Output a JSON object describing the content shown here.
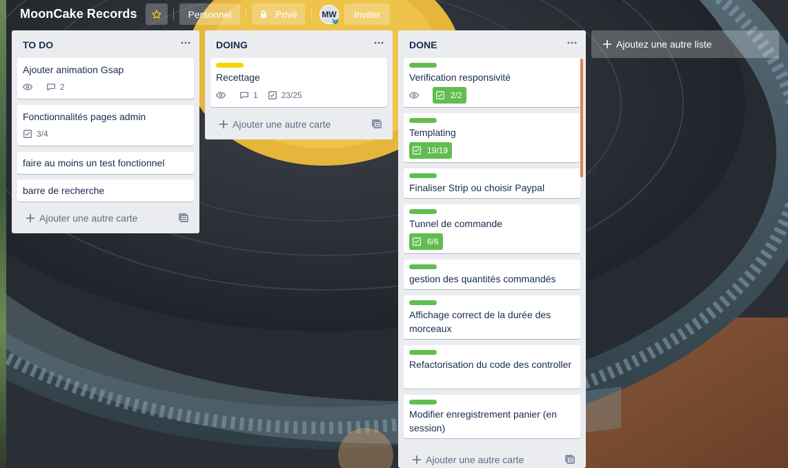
{
  "board": {
    "title": "MoonCake Records"
  },
  "header": {
    "star_icon": "star-icon",
    "visibility_team": "Personnel",
    "privacy_label": "Privé",
    "member_initials": "MW",
    "invite_label": "Inviter"
  },
  "colors": {
    "label_green": "#61bd4f",
    "label_yellow": "#f2d600",
    "done_badge": "#61bd4f",
    "list_bg": "#ebecf0"
  },
  "lists": [
    {
      "title": "TO DO",
      "add_card_label": "Ajouter une autre carte",
      "cards": [
        {
          "title": "Ajouter animation Gsap",
          "watch": true,
          "comments": "2"
        },
        {
          "title": "Fonctionnalités pages admin",
          "checklist": "3/4"
        },
        {
          "title": "faire au moins un test fonctionnel"
        },
        {
          "title": "barre de recherche"
        }
      ]
    },
    {
      "title": "DOING",
      "add_card_label": "Ajouter une autre carte",
      "cards": [
        {
          "title": "Recettage",
          "label": "yellow",
          "watch": true,
          "comments": "1",
          "checklist": "23/25"
        }
      ]
    },
    {
      "title": "DONE",
      "add_card_label": "Ajouter une autre carte",
      "cards": [
        {
          "title": "Verification responsivité",
          "label": "green",
          "watch": true,
          "checklist_done": "2/2"
        },
        {
          "title": "Templating",
          "label": "green",
          "checklist_done": "19/19"
        },
        {
          "title": "Finaliser Strip ou choisir Paypal",
          "label": "green"
        },
        {
          "title": "Tunnel de commande",
          "label": "green",
          "checklist_done": "6/6"
        },
        {
          "title": "gestion des quantités commandés",
          "label": "green"
        },
        {
          "title": "Affichage correct de la durée des morceaux",
          "label": "green"
        },
        {
          "title": "Refactorisation du code des controller",
          "label": "green"
        },
        {
          "title": "Modifier enregistrement panier (en session)",
          "label": "green"
        }
      ]
    }
  ],
  "add_list_label": "Ajoutez une autre liste"
}
